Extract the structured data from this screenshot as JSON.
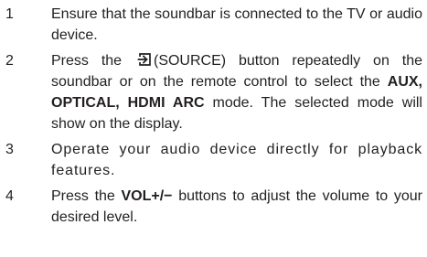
{
  "steps": [
    {
      "number": "1",
      "text": "Ensure that the soundbar is connected to the TV or audio device."
    },
    {
      "number": "2",
      "before_icon": "Press the",
      "icon": "source-input-icon",
      "after_icon": "(SOURCE) button repeatedly on the soundbar or on the remote control to select the",
      "modes": "AUX, OPTICAL, HDMI ARC",
      "after_modes": "mode. The selected mode will show on the display."
    },
    {
      "number": "3",
      "text": "Operate your audio device directly for playback features."
    },
    {
      "number": "4",
      "before_button": "Press the",
      "button": "VOL+/−",
      "after_button": "buttons to adjust the volume to your desired level."
    }
  ]
}
